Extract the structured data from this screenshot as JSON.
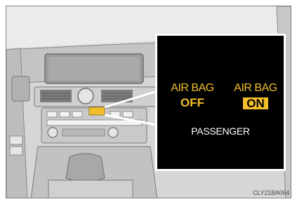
{
  "indicator": {
    "off_lamp": {
      "line1": "AIR BAG",
      "line2": "OFF"
    },
    "on_lamp": {
      "line1": "AIR BAG",
      "line2": "ON"
    },
    "caption": "PASSENGER",
    "color": "#f2bf2b"
  },
  "illustration": {
    "code": "CLY21BA064"
  }
}
